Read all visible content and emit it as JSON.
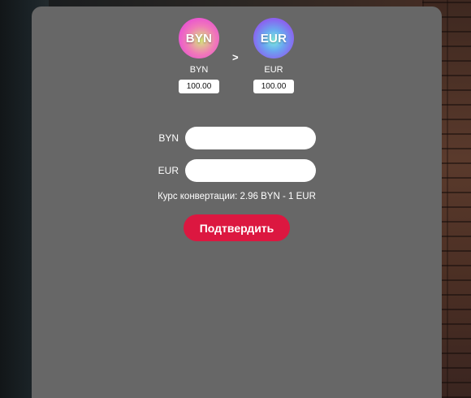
{
  "header": {
    "from": {
      "coin_text": "BYN",
      "label": "BYN",
      "amount": "100.00",
      "gradient": [
        "#d6e87a",
        "#f07ab8",
        "#e84bd6"
      ]
    },
    "arrow": ">",
    "to": {
      "coin_text": "EUR",
      "label": "EUR",
      "amount": "100.00",
      "gradient": [
        "#7ef0e0",
        "#6aa8f0",
        "#8a63f0"
      ]
    }
  },
  "form": {
    "byn_label": "BYN",
    "byn_value": "",
    "eur_label": "EUR",
    "eur_value": ""
  },
  "rate_text": "Курс конвертации: 2.96 BYN - 1 EUR",
  "confirm_label": "Подтвердить",
  "colors": {
    "panel": "#676767",
    "confirm": "#dc1740",
    "text": "#ffffff"
  }
}
